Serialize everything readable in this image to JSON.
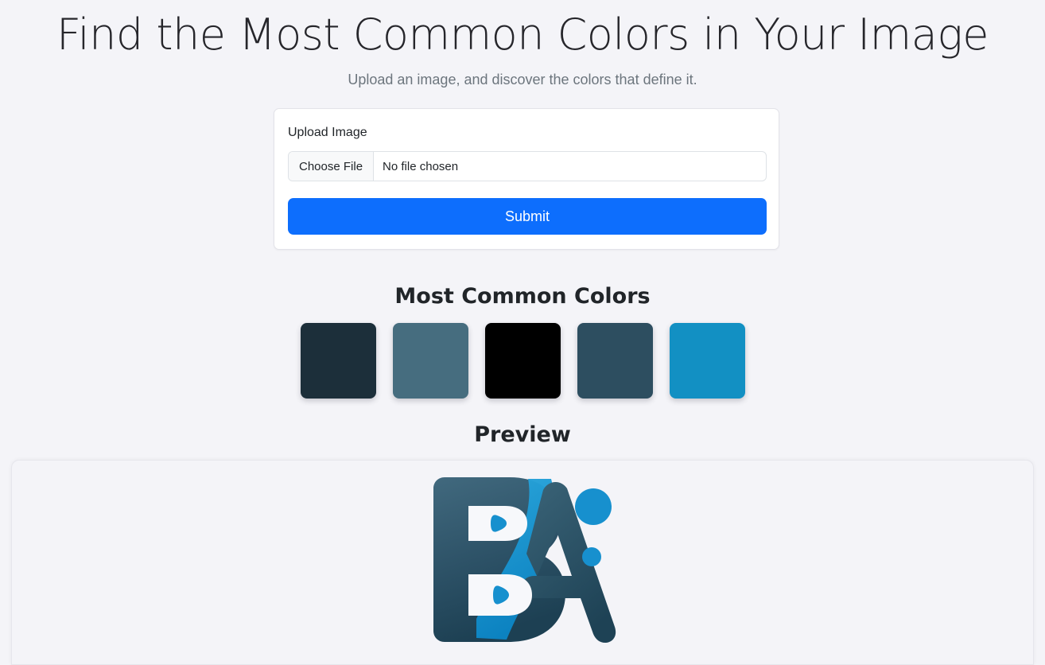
{
  "header": {
    "title": "Find the Most Common Colors in Your Image",
    "subtitle": "Upload an image, and discover the colors that define it."
  },
  "upload": {
    "label": "Upload Image",
    "choose_file_label": "Choose File",
    "file_name_text": "No file chosen",
    "submit_label": "Submit",
    "accent_color": "#0d6efd"
  },
  "results": {
    "colors_heading": "Most Common Colors",
    "preview_heading": "Preview",
    "swatches": [
      {
        "name": "swatch-1",
        "hex": "#1c2f3a"
      },
      {
        "name": "swatch-2",
        "hex": "#466d7f"
      },
      {
        "name": "swatch-3",
        "hex": "#000000"
      },
      {
        "name": "swatch-4",
        "hex": "#2d4e60"
      },
      {
        "name": "swatch-5",
        "hex": "#1290c3"
      }
    ]
  },
  "preview": {
    "image_alt": "BA monogram logo",
    "logo_colors": {
      "dark_top": "#3c6073",
      "dark_bottom": "#204255",
      "cyan": "#1790ce",
      "cyan_deep": "#0f86c4",
      "white": "#f7f8fb"
    },
    "background": "#f4f4f8"
  }
}
